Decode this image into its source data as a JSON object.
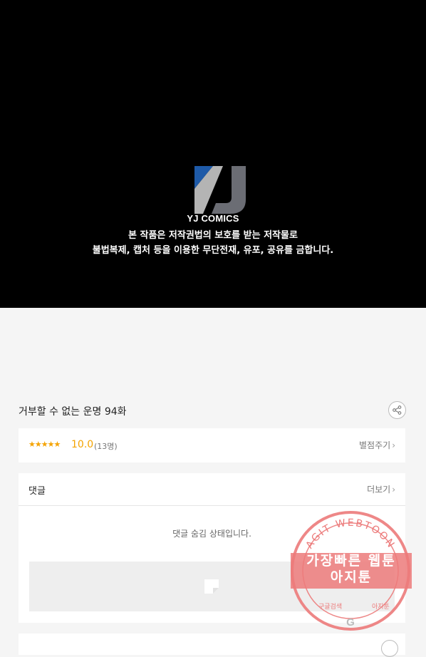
{
  "banner": {
    "brand": "YJ COMICS",
    "notice_line1": "본 작품은 저작권법의 보호를 받는 저작물로",
    "notice_line2": "불법복제, 캡처 등을 이용한 무단전재, 유포, 공유를 금합니다."
  },
  "episode": {
    "title": "거부할 수 없는 운명 94화"
  },
  "rating": {
    "stars": "★★★★★",
    "score": "10.0",
    "count": "(13명)",
    "rate_label": "별점주기",
    "star_fraction": 1.0
  },
  "comments": {
    "title": "댓글",
    "more_label": "더보기",
    "hidden_message": "댓글 숨김 상태입니다."
  },
  "bottom": {
    "label": ""
  },
  "watermark": {
    "arc_text": "AGIT WEBTOON",
    "line1": "가장빠른 웹툰",
    "line2": "아지툰",
    "left_small": "구글검색",
    "right_small": "아지툰",
    "google_glyph": "G",
    "color": "#ec7a7a"
  },
  "colors": {
    "banner_bg": "#000000",
    "accent": "#f4a300",
    "page_bg": "#f5f5f5"
  }
}
